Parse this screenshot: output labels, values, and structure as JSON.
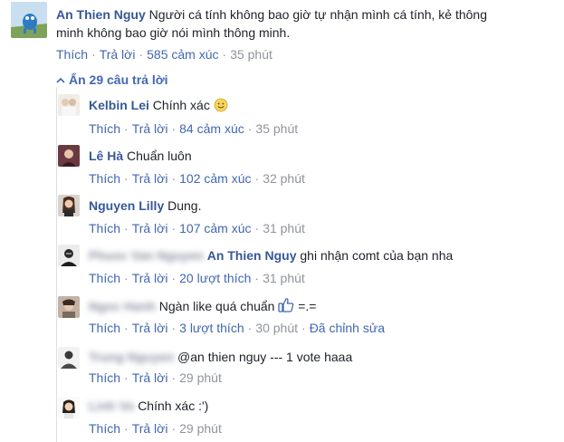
{
  "main_comment": {
    "author": "An Thien Nguy",
    "text_line1": "Người cá tính không bao giờ tự nhận mình cá tính, kẻ thông",
    "text_line2": "minh không bao giờ nói mình thông minh.",
    "like": "Thích",
    "reply": "Trả lời",
    "reactions": "585 cảm xúc",
    "time": "35 phút"
  },
  "hide_replies": "Ẩn 29 câu trả lời",
  "replies": [
    {
      "author": "Kelbin Lei",
      "text": "Chính xác",
      "emoji": "smile-emoji",
      "like": "Thích",
      "reply": "Trả lời",
      "reactions": "84 cảm xúc",
      "time": "35 phút"
    },
    {
      "author": "Lê Hà",
      "text": "Chuẩn luôn",
      "like": "Thích",
      "reply": "Trả lời",
      "reactions": "102 cảm xúc",
      "time": "32 phút"
    },
    {
      "author": "Nguyen Lilly",
      "text": "Dung.",
      "like": "Thích",
      "reply": "Trả lời",
      "reactions": "107 cảm xúc",
      "time": "31 phút"
    },
    {
      "author": "Phuoc Van Nguyen",
      "tag": "An Thien Nguy",
      "text": "ghi nhận comt của bạn nha",
      "like": "Thích",
      "reply": "Trả lời",
      "reactions": "20 lượt thích",
      "time": "31 phút"
    },
    {
      "author": "Ngoc Hanh",
      "text": "Ngàn like quá chuẩn",
      "text_after": "=.=",
      "like": "Thích",
      "reply": "Trả lời",
      "reactions": "3 lượt thích",
      "time": "30 phút",
      "edited": "Đã chỉnh sửa"
    },
    {
      "author": "Trung Nguyen",
      "text": "@an thien nguy --- 1 vote haaa",
      "like": "Thích",
      "reply": "Trả lời",
      "time": "29 phút"
    },
    {
      "author": "Linh Vo",
      "text": "Chính xác :')",
      "like": "Thích",
      "reply": "Trả lời",
      "time": "29 phút"
    }
  ]
}
